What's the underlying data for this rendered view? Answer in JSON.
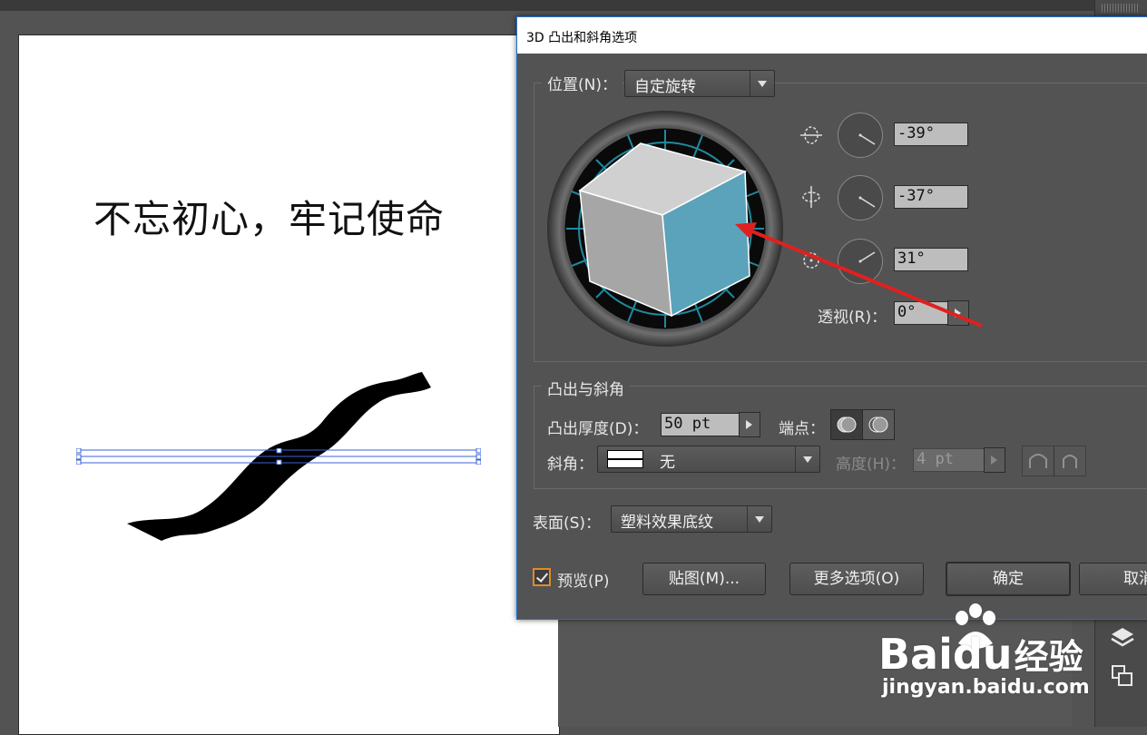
{
  "canvas": {
    "heading_text": "不忘初心，牢记使命"
  },
  "dialog": {
    "title": "3D 凸出和斜角选项",
    "position": {
      "label": "位置(N)：",
      "value": "自定旋转",
      "rotations": [
        "-39°",
        "-37°",
        "31°"
      ],
      "perspective_label": "透视(R)：",
      "perspective_value": "0°"
    },
    "extrude": {
      "group_label": "凸出与斜角",
      "depth_label": "凸出厚度(D)：",
      "depth_value": "50 pt",
      "cap_label": "端点：",
      "bevel_label": "斜角：",
      "bevel_value": "无",
      "height_label": "高度(H)：",
      "height_value": "4 pt"
    },
    "surface": {
      "label": "表面(S)：",
      "value": "塑料效果底纹"
    },
    "preview_label": "预览(P)",
    "preview_checked": true,
    "buttons": {
      "map": "贴图(M)...",
      "more": "更多选项(O)",
      "ok": "确定",
      "cancel": "取消"
    },
    "accent_color": "#e08a2b",
    "cube_side_color": "#5ba3bb"
  },
  "watermark": {
    "brand": "Bai",
    "brand_du": "du",
    "brand_cn": "经验",
    "url": "jingyan.baidu.com"
  }
}
